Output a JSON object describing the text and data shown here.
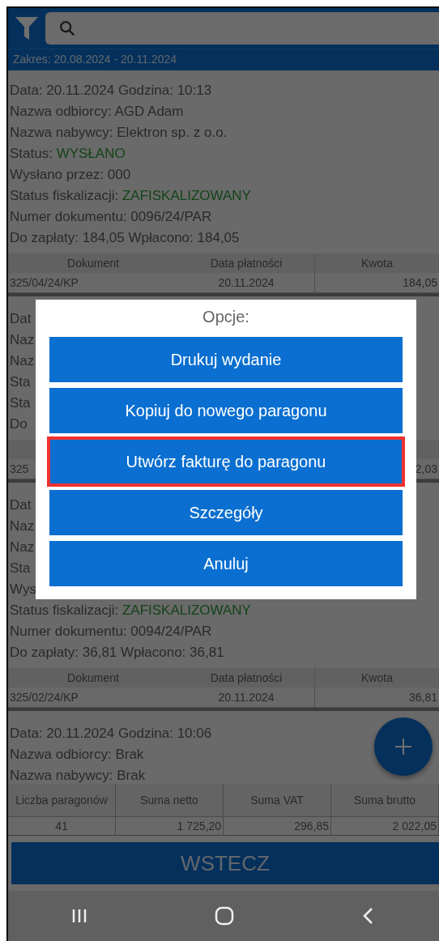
{
  "date_range": "Zakres:  20.08.2024  -  20.11.2024",
  "records": [
    {
      "lines": [
        {
          "kind": "plain",
          "text": "Data:  20.11.2024  Godzina:  10:13"
        },
        {
          "kind": "plain",
          "text": "Nazwa odbiorcy:  AGD Adam"
        },
        {
          "kind": "plain",
          "text": "Nazwa nabywcy:  Elektron sp. z o.o."
        },
        {
          "kind": "status",
          "label": "Status:",
          "value": "WYSŁANO"
        },
        {
          "kind": "plain",
          "text": "Wysłano przez:  000"
        },
        {
          "kind": "status",
          "label": "Status fiskalizacji:",
          "value": "ZAFISKALIZOWANY"
        },
        {
          "kind": "plain",
          "text": "Numer dokumentu:  0096/24/PAR"
        },
        {
          "kind": "plain",
          "text": "Do zapłaty:  184,05   Wpłacono:  184,05"
        }
      ],
      "payments": {
        "columns": [
          "Dokument",
          "Data płatności",
          "Kwota"
        ],
        "rows": [
          {
            "document": "325/04/24/KP",
            "date": "20.11.2024",
            "amount": "184,05"
          }
        ]
      }
    },
    {
      "lines": [
        {
          "kind": "plain",
          "text": "Dat"
        },
        {
          "kind": "plain",
          "text": "Naz"
        },
        {
          "kind": "plain",
          "text": "Naz"
        },
        {
          "kind": "plain",
          "text": "Sta"
        },
        {
          "kind": "plain",
          "text": "Sta"
        },
        {
          "kind": "plain",
          "text": "Do"
        }
      ],
      "payments": {
        "rows": [
          {
            "document": "325",
            "amount": "2,03"
          }
        ]
      }
    },
    {
      "lines": [
        {
          "kind": "plain",
          "text": "Dat"
        },
        {
          "kind": "plain",
          "text": "Naz"
        },
        {
          "kind": "plain",
          "text": "Naz"
        },
        {
          "kind": "plain",
          "text": "Sta"
        },
        {
          "kind": "plain",
          "text": "Wys"
        },
        {
          "kind": "status",
          "label": "Status fiskalizacji:",
          "value": "ZAFISKALIZOWANY"
        },
        {
          "kind": "plain",
          "text": "Numer dokumentu:  0094/24/PAR"
        },
        {
          "kind": "plain",
          "text": "Do zapłaty:  36,81   Wpłacono:  36,81"
        }
      ],
      "payments": {
        "columns": [
          "Dokument",
          "Data płatności",
          "Kwota"
        ],
        "rows": [
          {
            "document": "325/02/24/KP",
            "date": "20.11.2024",
            "amount": "36,81"
          }
        ]
      }
    },
    {
      "lines": [
        {
          "kind": "plain",
          "text": "Data:  20.11.2024  Godzina:  10:06"
        },
        {
          "kind": "plain",
          "text": "Nazwa odbiorcy:  Brak"
        },
        {
          "kind": "plain",
          "text": "Nazwa nabywcy:  Brak"
        }
      ]
    }
  ],
  "summary": {
    "columns": [
      "Liczba paragonów",
      "Suma netto",
      "Suma VAT",
      "Suma brutto"
    ],
    "values": [
      "41",
      "1 725,20",
      "296,85",
      "2 022,05"
    ]
  },
  "back_button": "WSTECZ",
  "dialog": {
    "title": "Opcje:",
    "options": [
      {
        "label": "Drukuj wydanie",
        "highlighted": false
      },
      {
        "label": "Kopiuj do nowego paragonu",
        "highlighted": false
      },
      {
        "label": "Utwórz fakturę do paragonu",
        "highlighted": true
      },
      {
        "label": "Szczegóły",
        "highlighted": false
      },
      {
        "label": "Anuluj",
        "highlighted": false
      }
    ]
  }
}
